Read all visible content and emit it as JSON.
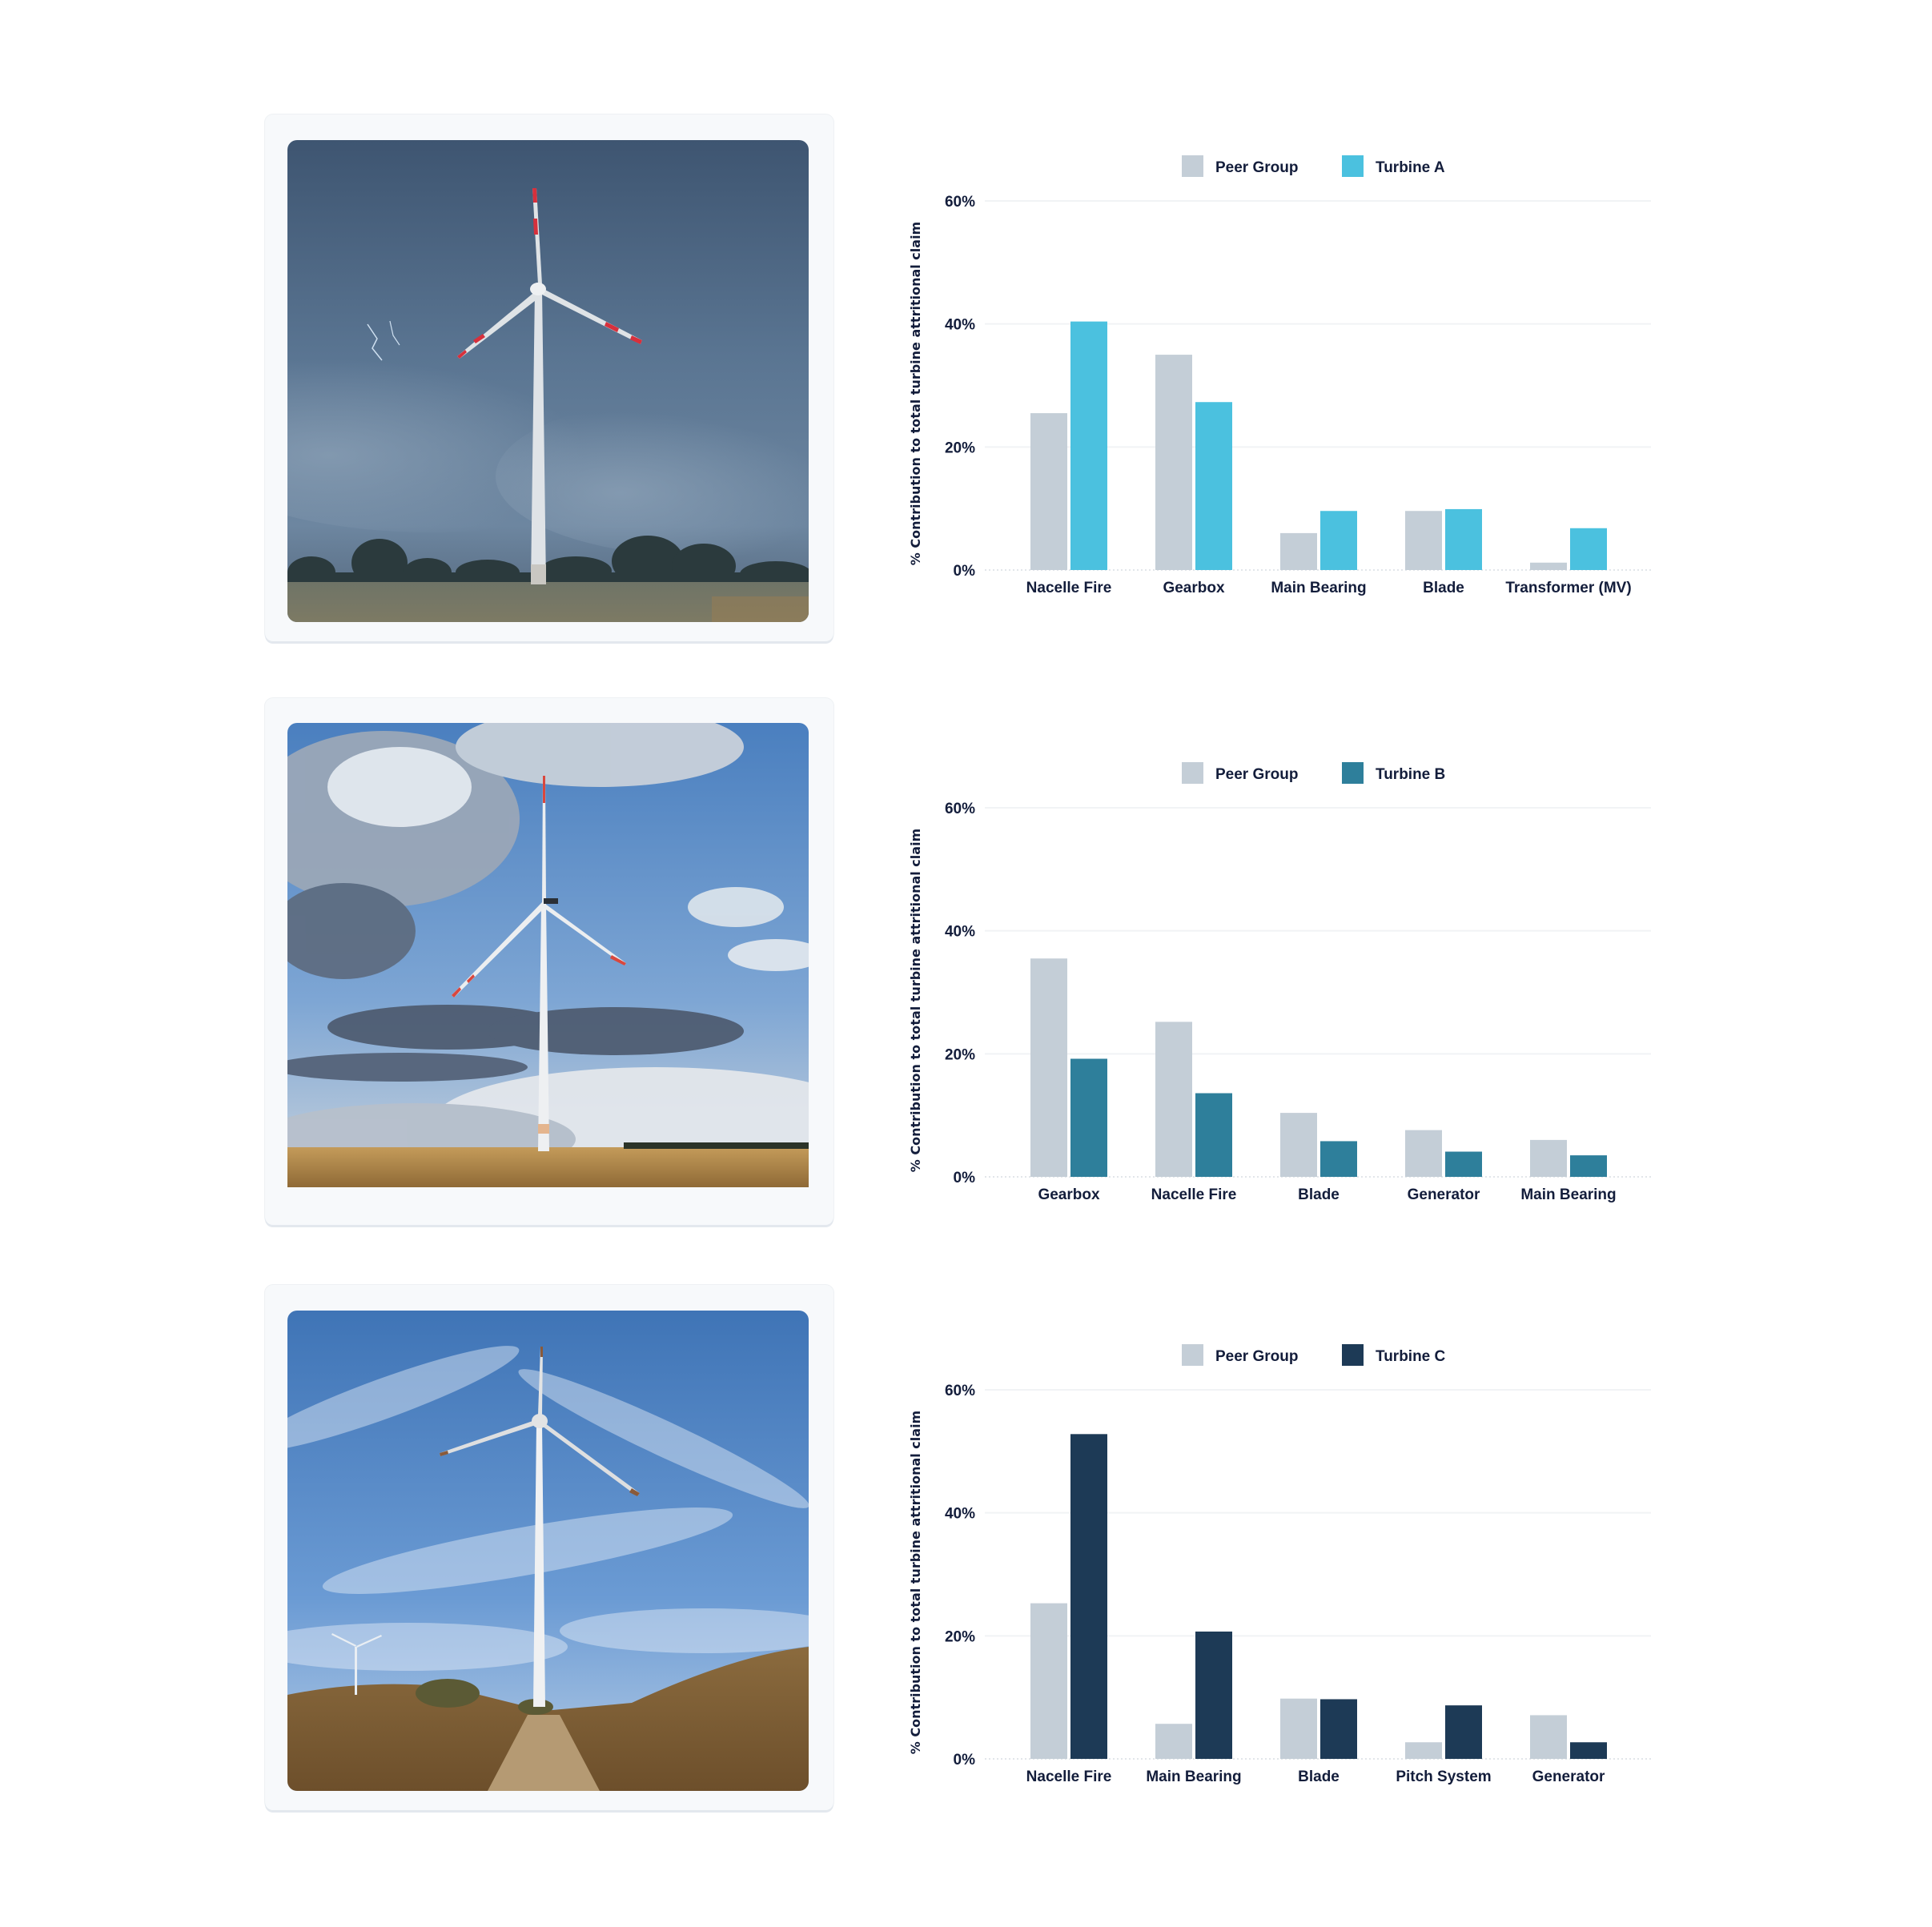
{
  "panels": [
    {
      "photo": {
        "scene": "stormy-sky",
        "description": "Wind turbine with red-striped blades under dark storm clouds with lightning, trees and field"
      },
      "chart_data": {
        "type": "bar",
        "title": "",
        "xlabel": "",
        "ylabel": "% Contribution to total turbine attritional claim",
        "ylim": [
          0,
          60
        ],
        "yticks": [
          0,
          20,
          40,
          60
        ],
        "ytick_labels": [
          "0%",
          "20%",
          "40%",
          "60%"
        ],
        "grid": true,
        "legend_position": "top-center",
        "categories": [
          "Nacelle Fire",
          "Gearbox",
          "Main Bearing",
          "Blade",
          "Transformer (MV)"
        ],
        "series": [
          {
            "name": "Peer Group",
            "color": "#c4ced7",
            "values": [
              25.5,
              35.0,
              6.0,
              9.6,
              1.2
            ]
          },
          {
            "name": "Turbine A",
            "color": "#4bc1df",
            "values": [
              40.4,
              27.3,
              9.6,
              9.9,
              6.8
            ]
          }
        ]
      }
    },
    {
      "photo": {
        "scene": "partly-cloudy",
        "description": "Wind turbine against blue sky with cumulus clouds over golden field"
      },
      "chart_data": {
        "type": "bar",
        "title": "",
        "xlabel": "",
        "ylabel": "% Contribution to total turbine attritional claim",
        "ylim": [
          0,
          60
        ],
        "yticks": [
          0,
          20,
          40,
          60
        ],
        "ytick_labels": [
          "0%",
          "20%",
          "40%",
          "60%"
        ],
        "grid": true,
        "legend_position": "top-center",
        "categories": [
          "Gearbox",
          "Nacelle Fire",
          "Blade",
          "Generator",
          "Main Bearing"
        ],
        "series": [
          {
            "name": "Peer Group",
            "color": "#c4ced7",
            "values": [
              35.5,
              25.2,
              10.4,
              7.6,
              6.0
            ]
          },
          {
            "name": "Turbine B",
            "color": "#2e7f9b",
            "values": [
              19.2,
              13.6,
              5.8,
              4.1,
              3.5
            ]
          }
        ]
      }
    },
    {
      "photo": {
        "scene": "blue-sky",
        "description": "Wind turbine under bright blue sky with wispy clouds above dirt path and dry grass hills"
      },
      "chart_data": {
        "type": "bar",
        "title": "",
        "xlabel": "",
        "ylabel": "% Contribution to total turbine attritional claim",
        "ylim": [
          0,
          60
        ],
        "yticks": [
          0,
          20,
          40,
          60
        ],
        "ytick_labels": [
          "0%",
          "20%",
          "40%",
          "60%"
        ],
        "grid": true,
        "legend_position": "top-center",
        "categories": [
          "Nacelle Fire",
          "Main Bearing",
          "Blade",
          "Pitch System",
          "Generator"
        ],
        "series": [
          {
            "name": "Peer Group",
            "color": "#c4ced7",
            "values": [
              25.3,
              5.7,
              9.8,
              2.7,
              7.1
            ]
          },
          {
            "name": "Turbine C",
            "color": "#1d3a56",
            "values": [
              52.8,
              20.7,
              9.7,
              8.7,
              2.7
            ]
          }
        ]
      }
    }
  ],
  "chart_data": [
    {
      "ref": "panels.0.chart_data"
    },
    {
      "ref": "panels.1.chart_data"
    },
    {
      "ref": "panels.2.chart_data"
    }
  ]
}
